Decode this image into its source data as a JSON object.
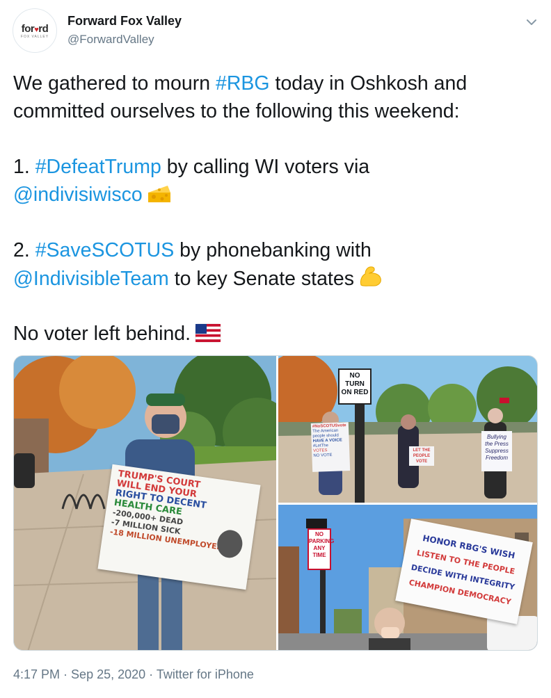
{
  "author": {
    "display_name": "Forward Fox Valley",
    "handle": "@ForwardValley",
    "avatar_word_left": "for",
    "avatar_word_heart": "♥",
    "avatar_word_right": "rd",
    "avatar_sub": "FOX VALLEY"
  },
  "tweet": {
    "line1_pre": "We gathered to mourn ",
    "line1_tag": "#RBG",
    "line1_post": " today in Oshkosh and",
    "line2": "committed ourselves to the following this weekend:",
    "item1_num": "1. ",
    "item1_tag": "#DefeatTrump",
    "item1_post": " by calling WI voters via",
    "item1_mention": "@indivisiwisco",
    "item2_num": "2. ",
    "item2_tag": "#SaveSCOTUS",
    "item2_post": " by phonebanking with",
    "item2_mention": "@IndivisibleTeam",
    "item2_post2": " to key Senate states",
    "closing": "No voter left behind."
  },
  "photos": {
    "sign1": [
      "TRUMP'S COURT",
      "WILL END YOUR",
      "RIGHT TO DECENT",
      "HEALTH CARE",
      "-200,000+ DEAD",
      "-7 MILLION SICK",
      "-18 MILLION UNEMPLOYED"
    ],
    "street_sign": [
      "NO",
      "TURN",
      "ON RED"
    ],
    "sign_bully": [
      "Bullying",
      "the Press",
      "Suppress",
      "Freedom"
    ],
    "sign_left": [
      "#NoSCOTUSvote",
      "The American",
      "people should",
      "HAVE A VOICE",
      "#LetThe",
      "VOTES",
      "NO VOTE"
    ],
    "sign_mid": [
      "LET THE",
      "PEOPLE",
      "VOTE"
    ],
    "parking_sign": [
      "NO",
      "PARKING",
      "ANY",
      "TIME"
    ],
    "sign2": [
      "HONOR RBG'S WISH",
      "LISTEN TO THE PEOPLE",
      "DECIDE WITH INTEGRITY",
      "CHAMPION DEMOCRACY"
    ]
  },
  "footer": {
    "time": "4:17 PM",
    "sep1": " · ",
    "date": "Sep 25, 2020",
    "sep2": " · ",
    "source": "Twitter for iPhone"
  },
  "colors": {
    "link": "#1b95e0",
    "text": "#14171a",
    "muted": "#657786"
  },
  "icons": [
    "chevron-down-icon",
    "cheese-emoji",
    "flexed-biceps-emoji",
    "us-flag-emoji"
  ]
}
